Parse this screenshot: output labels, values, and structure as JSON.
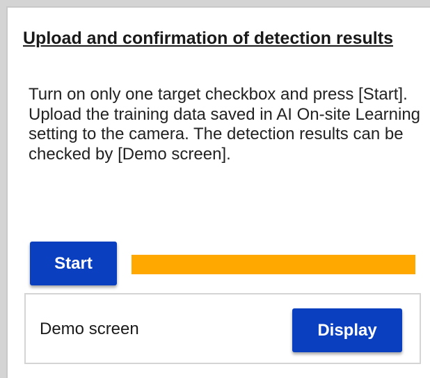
{
  "section": {
    "title": "Upload and confirmation of detection results",
    "description_lines": [
      "Turn on only one target checkbox and press [Start].",
      "Upload the training data saved in AI On-site Learning setting to the camera. The detection results can be checked by [Demo screen]."
    ]
  },
  "actions": {
    "start_label": "Start"
  },
  "progress": {
    "value_percent": 100,
    "color": "#ffa800"
  },
  "demo": {
    "label": "Demo screen",
    "display_label": "Display"
  },
  "colors": {
    "button_primary": "#0a3fbf",
    "progress": "#ffa800"
  }
}
